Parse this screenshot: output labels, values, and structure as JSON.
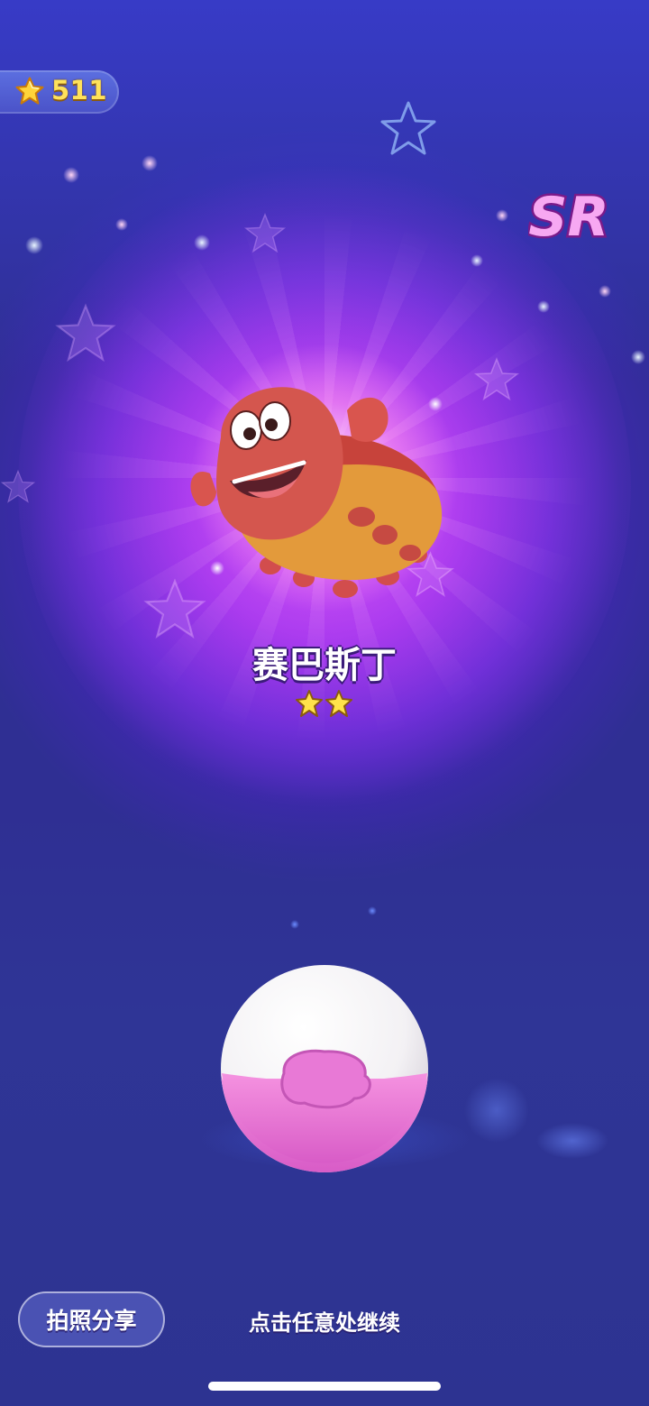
{
  "score": {
    "value": "511",
    "icon": "star-icon"
  },
  "rarity_badge": {
    "label": "SR"
  },
  "character": {
    "name": "赛巴斯丁",
    "stars": 2,
    "image": "red-crab-creature"
  },
  "capture_ball": {
    "icon": "capture-ball-icon"
  },
  "footer": {
    "share_label": "拍照分享",
    "continue_hint": "点击任意处继续"
  },
  "colors": {
    "score_text": "#ffe25a",
    "background_top": "#3a3fd8",
    "background_bottom": "#2d3391",
    "glow": "#b23cf0",
    "sr_badge": "#e24fe0"
  }
}
